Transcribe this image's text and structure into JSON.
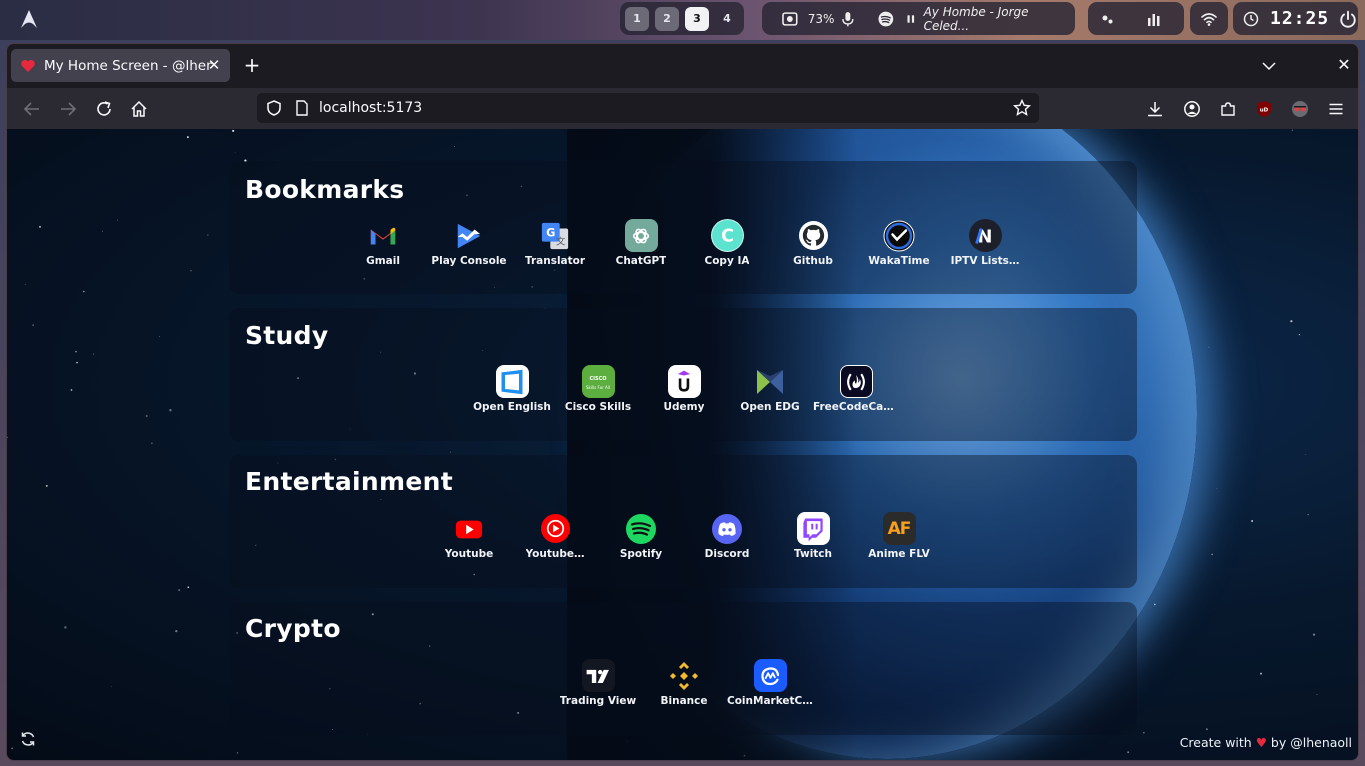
{
  "system_bar": {
    "workspaces": [
      "1",
      "2",
      "3",
      "4"
    ],
    "active_workspace": "3",
    "volume": "73%",
    "media": "Ay Hombe - Jorge Celed...",
    "clock": "12:25",
    "icons": [
      "arch-logo-icon",
      "screen-record-icon",
      "microphone-icon",
      "spotify-icon",
      "pause-icon",
      "tray-icon",
      "equalizer-icon",
      "wifi-icon",
      "clock-icon",
      "power-icon"
    ]
  },
  "browser": {
    "tab_title": "My Home Screen - @lhenaoll",
    "tab_close": "✕",
    "new_tab": "+",
    "window_close": "✕",
    "url": "localhost:5173"
  },
  "sections": [
    {
      "title": "Bookmarks",
      "links": [
        {
          "label": "Gmail",
          "icon": "gmail-icon"
        },
        {
          "label": "Play Console",
          "icon": "play-console-icon"
        },
        {
          "label": "Translator",
          "icon": "translator-icon"
        },
        {
          "label": "ChatGPT",
          "icon": "chatgpt-icon"
        },
        {
          "label": "Copy IA",
          "icon": "copy-ai-icon"
        },
        {
          "label": "Github",
          "icon": "github-icon"
        },
        {
          "label": "WakaTime",
          "icon": "wakatime-icon"
        },
        {
          "label": "IPTV Lists…",
          "icon": "iptv-icon"
        }
      ]
    },
    {
      "title": "Study",
      "links": [
        {
          "label": "Open English",
          "icon": "open-english-icon"
        },
        {
          "label": "Cisco Skills",
          "icon": "cisco-icon"
        },
        {
          "label": "Udemy",
          "icon": "udemy-icon"
        },
        {
          "label": "Open EDG",
          "icon": "open-edg-icon"
        },
        {
          "label": "FreeCodeCamp",
          "icon": "freecodecamp-icon"
        }
      ]
    },
    {
      "title": "Entertainment",
      "links": [
        {
          "label": "Youtube",
          "icon": "youtube-icon"
        },
        {
          "label": "Youtube…",
          "icon": "youtube-music-icon"
        },
        {
          "label": "Spotify",
          "icon": "spotify-icon"
        },
        {
          "label": "Discord",
          "icon": "discord-icon"
        },
        {
          "label": "Twitch",
          "icon": "twitch-icon"
        },
        {
          "label": "Anime FLV",
          "icon": "animeflv-icon"
        }
      ]
    },
    {
      "title": "Crypto",
      "links": [
        {
          "label": "Trading View",
          "icon": "tradingview-icon"
        },
        {
          "label": "Binance",
          "icon": "binance-icon"
        },
        {
          "label": "CoinMarketCap",
          "icon": "coinmarketcap-icon"
        }
      ]
    }
  ],
  "icon_text": {
    "cisco": "CISCO",
    "cisco_sub": "Skills For All",
    "udemy": "U",
    "fcc": "(🔥)",
    "animeflv": "AF",
    "tradingview": "TV",
    "iptv": "N",
    "copyai": "C"
  },
  "footer": {
    "credit_prefix": "Create with",
    "heart": "♥",
    "credit_suffix": "by @lhenaoll"
  },
  "colors": {
    "accent_red": "#e8283d",
    "page_bg": "#07182d"
  }
}
